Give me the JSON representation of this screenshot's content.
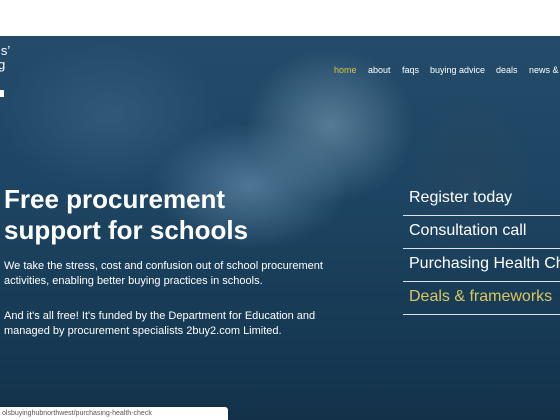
{
  "logo": {
    "line1": "ls’",
    "line2": "g"
  },
  "nav": {
    "items": [
      {
        "label": "home",
        "active": true
      },
      {
        "label": "about",
        "active": false
      },
      {
        "label": "faqs",
        "active": false
      },
      {
        "label": "buying advice",
        "active": false
      },
      {
        "label": "deals",
        "active": false
      },
      {
        "label": "news & e",
        "active": false
      }
    ]
  },
  "hero": {
    "headline_line1": "Free procurement",
    "headline_line2": "support for schools",
    "paragraph1": "We take the stress, cost and confusion out of school procurement activities, enabling better buying practices in schools.",
    "paragraph2": "And it's all free! It's funded by the Department for Education and managed by procurement specialists 2buy2.com Limited."
  },
  "sidebar": {
    "items": [
      {
        "label": "Register today"
      },
      {
        "label": "Consultation call"
      },
      {
        "label": "Purchasing Health Ch"
      },
      {
        "label": "Deals & frameworks"
      }
    ]
  },
  "status": {
    "url": "olsbuyinghubnorthwest/purchasing-health-check"
  },
  "colors": {
    "active": "#d8c347",
    "gold": "#d9c760",
    "hero": "#1d4563"
  }
}
